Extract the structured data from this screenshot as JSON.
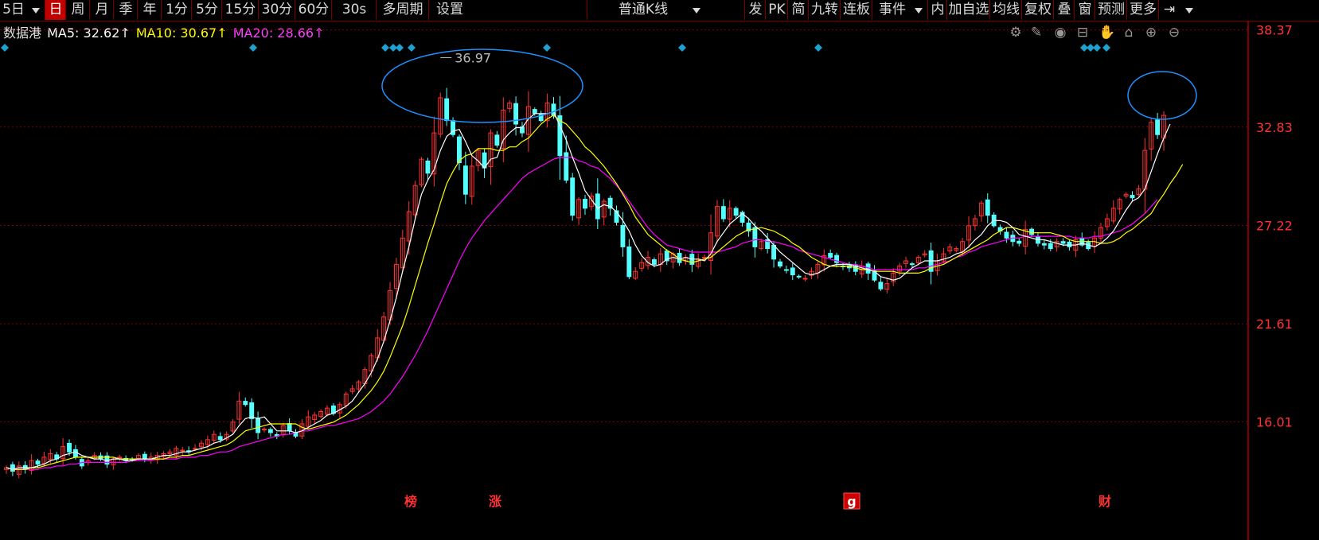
{
  "toolbar": {
    "period_dropdown": "5日",
    "periods": [
      "日",
      "周",
      "月",
      "季",
      "年",
      "1分",
      "5分",
      "15分",
      "30分",
      "60分",
      "30s",
      "多周期",
      "设置"
    ],
    "active_period": "日",
    "kline_type": "普通K线",
    "right_buttons": [
      "发",
      "PK",
      "简",
      "九转",
      "连板",
      "事件",
      "内",
      "加自选",
      "均线",
      "复权",
      "叠",
      "窗",
      "预测",
      "更多"
    ]
  },
  "legend": {
    "name": "数据港",
    "ma5": "MA5: 32.62↑",
    "ma10": "MA10: 30.67↑",
    "ma20": "MA20: 28.66↑"
  },
  "colors": {
    "up": "#ff3232",
    "down": "#54ffff",
    "ma5": "#ffffff",
    "ma10": "#ffff00",
    "ma20": "#ff00ff",
    "grid": "#800000",
    "axis_text": "#ff3232",
    "marker": "#1ea0d0",
    "highlight": "#1e90ff"
  },
  "chart_data": {
    "type": "candlestick",
    "y_ticks": [
      "38.37",
      "32.83",
      "27.22",
      "21.61",
      "16.01"
    ],
    "ylim": [
      10.5,
      38.9
    ],
    "peak_label": "36.97",
    "bottom_markers": [
      "榜",
      "涨",
      "g",
      "财"
    ],
    "close": [
      13.4,
      13.2,
      13.5,
      13.3,
      13.8,
      13.6,
      14.0,
      14.2,
      13.9,
      14.6,
      14.3,
      14.0,
      13.5,
      13.8,
      14.1,
      13.9,
      13.6,
      13.9,
      14.0,
      13.8,
      13.9,
      14.1,
      13.9,
      14.0,
      14.1,
      14.2,
      14.3,
      14.5,
      14.4,
      14.3,
      14.5,
      14.8,
      15.0,
      15.3,
      15.0,
      15.3,
      16.0,
      17.2,
      17.0,
      16.2,
      15.4,
      15.6,
      15.4,
      15.2,
      15.8,
      15.5,
      15.2,
      15.9,
      16.3,
      16.4,
      16.6,
      16.8,
      16.5,
      17.0,
      17.6,
      17.9,
      18.3,
      19.0,
      19.8,
      20.8,
      22.0,
      23.5,
      25.0,
      26.5,
      28.0,
      29.5,
      31.0,
      30.2,
      32.5,
      34.5,
      33.2,
      32.4,
      30.8,
      29.0,
      30.6,
      31.5,
      30.5,
      32.5,
      31.8,
      33.8,
      34.2,
      33.0,
      32.5,
      34.0,
      33.6,
      33.2,
      34.2,
      33.5,
      31.2,
      29.8,
      27.8,
      28.7,
      28.2,
      28.9,
      27.6,
      28.6,
      28.2,
      27.4,
      26.0,
      24.3,
      24.6,
      25.1,
      25.4,
      25.0,
      25.6,
      25.2,
      25.6,
      25.1,
      25.4,
      25.0,
      25.3,
      25.4,
      26.8,
      28.3,
      27.6,
      28.2,
      27.8,
      27.4,
      26.9,
      26.0,
      26.3,
      25.9,
      25.3,
      24.9,
      24.7,
      24.4,
      24.3,
      24.2,
      24.6,
      25.0,
      25.5,
      25.4,
      25.1,
      24.9,
      24.8,
      24.6,
      24.9,
      24.5,
      24.1,
      23.6,
      23.9,
      24.5,
      24.9,
      25.2,
      25.0,
      25.4,
      25.6,
      24.6,
      25.2,
      25.6,
      26.0,
      25.9,
      26.3,
      27.2,
      27.6,
      28.5,
      27.8,
      27.2,
      26.9,
      26.5,
      26.3,
      26.2,
      27.0,
      26.7,
      26.2,
      26.1,
      25.9,
      26.3,
      26.2,
      26.0,
      26.4,
      26.1,
      25.9,
      26.5,
      27.1,
      27.6,
      28.2,
      28.7,
      29.0,
      28.8,
      29.3,
      31.5,
      33.1,
      32.4,
      33.5
    ],
    "ma5": [
      13.4,
      13.3,
      13.4,
      13.4,
      13.4,
      13.5,
      13.6,
      13.8,
      13.9,
      14.1,
      14.2,
      14.3,
      14.1,
      14.0,
      13.9,
      13.9,
      13.8,
      13.9,
      13.9,
      13.8,
      13.8,
      13.9,
      13.9,
      13.9,
      14.0,
      14.1,
      14.1,
      14.2,
      14.3,
      14.3,
      14.4,
      14.5,
      14.6,
      14.8,
      14.9,
      15.1,
      15.3,
      15.8,
      16.2,
      16.3,
      16.2,
      16.3,
      15.9,
      15.5,
      15.5,
      15.5,
      15.4,
      15.5,
      15.7,
      15.9,
      16.1,
      16.4,
      16.5,
      16.7,
      16.9,
      17.2,
      17.7,
      18.2,
      18.8,
      19.6,
      20.6,
      21.8,
      23.1,
      24.6,
      26.0,
      27.6,
      29.0,
      29.8,
      30.4,
      31.5,
      32.3,
      32.6,
      32.7,
      32.0,
      31.2,
      30.9,
      30.5,
      31.0,
      31.1,
      32.1,
      32.5,
      32.8,
      32.8,
      33.3,
      33.6,
      33.6,
      33.6,
      33.7,
      32.9,
      32.1,
      31.1,
      30.2,
      29.2,
      28.7,
      28.2,
      28.4,
      28.3,
      28.0,
      27.5,
      26.9,
      26.1,
      25.5,
      25.1,
      24.9,
      25.0,
      25.3,
      25.4,
      25.3,
      25.4,
      25.3,
      25.3,
      25.2,
      25.6,
      26.3,
      26.8,
      27.3,
      27.6,
      27.9,
      27.6,
      27.2,
      26.9,
      26.5,
      26.1,
      25.7,
      25.4,
      25.1,
      24.8,
      24.5,
      24.4,
      24.5,
      24.7,
      24.9,
      25.0,
      25.0,
      25.0,
      24.9,
      24.8,
      24.7,
      24.6,
      24.3,
      24.2,
      24.1,
      24.2,
      24.5,
      24.8,
      25.0,
      25.2,
      25.2,
      25.2,
      25.3,
      25.4,
      25.6,
      25.7,
      26.0,
      26.4,
      26.7,
      27.2,
      27.5,
      27.5,
      27.4,
      27.1,
      26.7,
      26.6,
      26.5,
      26.4,
      26.4,
      26.3,
      26.2,
      26.1,
      26.1,
      26.1,
      26.2,
      26.1,
      26.0,
      26.2,
      26.5,
      26.9,
      27.5,
      28.1,
      28.6,
      28.8,
      29.3,
      30.3,
      31.3,
      32.2,
      33.0
    ],
    "ma10": [
      13.4,
      13.3,
      13.3,
      13.3,
      13.4,
      13.4,
      13.5,
      13.6,
      13.7,
      13.8,
      13.9,
      14.0,
      14.0,
      14.0,
      14.0,
      14.0,
      14.0,
      14.0,
      13.9,
      13.9,
      13.9,
      13.9,
      13.9,
      13.9,
      13.9,
      13.9,
      14.0,
      14.0,
      14.1,
      14.1,
      14.2,
      14.3,
      14.4,
      14.5,
      14.6,
      14.7,
      14.9,
      15.2,
      15.5,
      15.6,
      15.7,
      15.8,
      15.9,
      15.9,
      15.9,
      15.9,
      15.9,
      15.7,
      15.6,
      15.7,
      15.8,
      15.9,
      16.0,
      16.2,
      16.4,
      16.7,
      17.0,
      17.4,
      17.8,
      18.3,
      18.9,
      19.7,
      20.6,
      21.5,
      22.6,
      23.8,
      25.0,
      26.2,
      27.3,
      28.5,
      29.6,
      30.3,
      30.9,
      31.2,
      31.3,
      31.6,
      31.6,
      31.6,
      31.5,
      31.5,
      31.7,
      31.7,
      32.0,
      32.2,
      32.6,
      33.0,
      33.3,
      33.5,
      33.2,
      33.0,
      32.6,
      32.2,
      31.7,
      31.4,
      31.0,
      30.6,
      30.1,
      29.6,
      29.0,
      28.4,
      27.7,
      27.2,
      26.7,
      26.4,
      26.1,
      25.8,
      25.6,
      25.3,
      25.2,
      25.1,
      25.2,
      25.3,
      25.4,
      25.7,
      26.0,
      26.3,
      26.6,
      26.8,
      27.0,
      27.0,
      27.1,
      27.0,
      26.9,
      26.7,
      26.5,
      26.2,
      26.0,
      25.7,
      25.4,
      25.2,
      25.0,
      24.9,
      24.9,
      24.9,
      24.9,
      24.8,
      24.7,
      24.7,
      24.6,
      24.6,
      24.6,
      24.6,
      24.5,
      24.5,
      24.5,
      24.5,
      24.6,
      24.8,
      24.9,
      25.0,
      25.2,
      25.4,
      25.6,
      25.8,
      26.0,
      26.2,
      26.4,
      26.7,
      26.9,
      27.1,
      27.1,
      27.0,
      26.9,
      26.8,
      26.8,
      26.8,
      26.8,
      26.7,
      26.6,
      26.4,
      26.3,
      26.3,
      26.3,
      26.3,
      26.2,
      26.2,
      26.3,
      26.5,
      26.8,
      27.0,
      27.3,
      27.6,
      27.9,
      28.5,
      29.0,
      29.6,
      30.1,
      30.7
    ],
    "ma20": [
      13.4,
      13.3,
      13.3,
      13.3,
      13.3,
      13.3,
      13.4,
      13.4,
      13.5,
      13.5,
      13.6,
      13.6,
      13.7,
      13.7,
      13.7,
      13.7,
      13.7,
      13.7,
      13.7,
      13.7,
      13.8,
      13.8,
      13.8,
      13.8,
      13.9,
      13.9,
      13.9,
      13.9,
      14.0,
      14.0,
      14.0,
      14.1,
      14.1,
      14.2,
      14.3,
      14.3,
      14.4,
      14.6,
      14.7,
      14.8,
      14.9,
      15.0,
      15.1,
      15.2,
      15.3,
      15.3,
      15.4,
      15.5,
      15.5,
      15.6,
      15.7,
      15.8,
      15.8,
      15.9,
      16.0,
      16.1,
      16.2,
      16.4,
      16.6,
      16.9,
      17.2,
      17.6,
      18.1,
      18.6,
      19.2,
      19.8,
      20.5,
      21.2,
      22.0,
      22.8,
      23.6,
      24.4,
      25.2,
      25.9,
      26.5,
      27.0,
      27.5,
      27.9,
      28.3,
      28.7,
      29.1,
      29.5,
      29.9,
      30.2,
      30.4,
      30.6,
      30.8,
      31.0,
      31.1,
      31.1,
      31.1,
      30.9,
      30.8,
      30.6,
      30.5,
      30.2,
      29.9,
      29.5,
      29.1,
      28.6,
      28.1,
      27.6,
      27.1,
      26.7,
      26.4,
      26.1,
      26.0,
      25.9,
      25.8,
      25.7,
      25.7,
      25.7,
      25.7,
      25.7,
      25.8,
      25.9,
      26.0,
      26.2,
      26.3,
      26.4,
      26.4,
      26.3,
      26.3,
      26.2,
      26.1,
      26.0,
      25.8,
      25.7,
      25.6,
      25.5,
      25.4,
      25.3,
      25.2,
      25.1,
      25.0,
      25.0,
      24.9,
      24.8,
      24.7,
      24.7,
      24.7,
      24.7,
      24.7,
      24.7,
      24.7,
      24.8,
      24.8,
      24.9,
      25.0,
      25.1,
      25.2,
      25.4,
      25.5,
      25.7,
      25.8,
      26.0,
      26.1,
      26.2,
      26.3,
      26.4,
      26.5,
      26.5,
      26.6,
      26.6,
      26.6,
      26.6,
      26.6,
      26.6,
      26.6,
      26.6,
      26.5,
      26.5,
      26.5,
      26.6,
      26.6,
      26.7,
      26.8,
      26.9,
      27.1,
      27.3,
      27.6,
      27.9,
      28.3,
      28.7
    ]
  }
}
